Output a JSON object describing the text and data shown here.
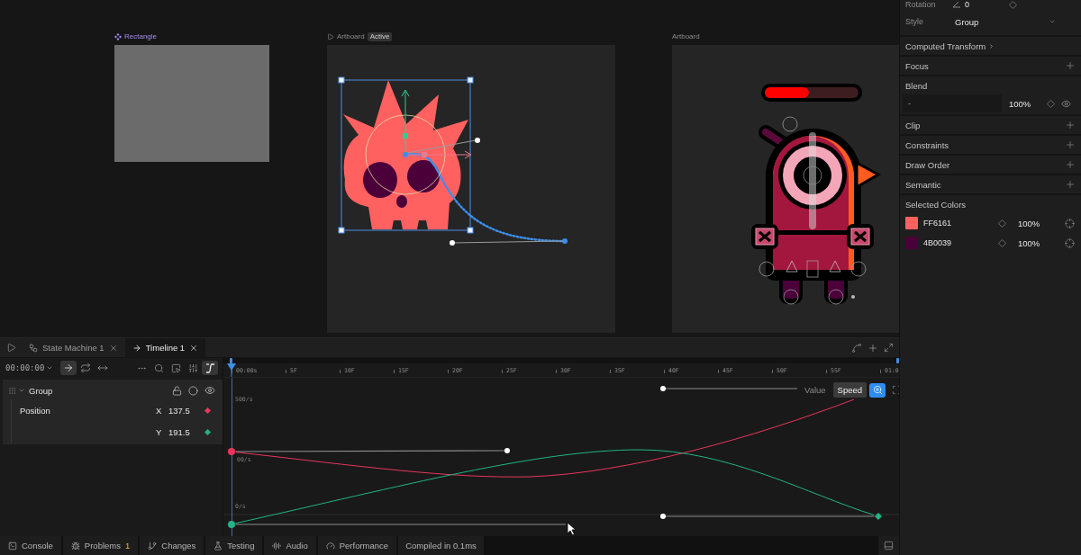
{
  "canvas": {
    "artboards": [
      {
        "kind": "rectangle",
        "label": "Rectangle"
      },
      {
        "kind": "skull",
        "label": "Artboard",
        "badge": "Active"
      },
      {
        "kind": "character",
        "label": "Artboard",
        "health_bar": {
          "level": 0.47
        }
      }
    ]
  },
  "timeline": {
    "tabs": [
      {
        "kind": "state_machine",
        "label": "State Machine 1",
        "selected": false
      },
      {
        "kind": "timeline",
        "label": "Timeline 1",
        "selected": true
      }
    ],
    "time": "00:00:00",
    "playback_modes": [
      {
        "kind": "one_shot",
        "selected": true
      },
      {
        "kind": "loop",
        "selected": false
      },
      {
        "kind": "ping_pong",
        "selected": false
      }
    ],
    "tools": [
      {
        "kind": "more",
        "selected": false
      },
      {
        "kind": "search",
        "selected": false
      },
      {
        "kind": "select",
        "selected": false
      },
      {
        "kind": "filter",
        "selected": false
      },
      {
        "kind": "ease",
        "selected": true
      }
    ],
    "ruler": [
      "00:00s",
      "5F",
      "10F",
      "15F",
      "20F",
      "25F",
      "30F",
      "35F",
      "40F",
      "45F",
      "50F",
      "55F",
      "01:0"
    ],
    "layers": [
      {
        "name": "Group",
        "expanded": true,
        "children": [
          {
            "name": "Position",
            "values": [
              {
                "axis": "X",
                "value": "137.5",
                "color": "#e8365a"
              },
              {
                "axis": "Y",
                "value": "191.5",
                "color": "#20b486"
              }
            ]
          }
        ]
      }
    ],
    "graph": {
      "axis_labels": [
        "500/s",
        "00/s",
        "0/s"
      ],
      "modes": [
        {
          "label": "Value",
          "selected": false
        },
        {
          "label": "Speed",
          "selected": true
        }
      ],
      "buttons": [
        {
          "kind": "zoom",
          "selected": true
        },
        {
          "kind": "fit",
          "selected": false
        }
      ]
    }
  },
  "inspector": {
    "rotation": {
      "label": "Rotation",
      "value": "0"
    },
    "style": {
      "label": "Style",
      "value": "Group"
    },
    "sections": [
      {
        "kind": "link",
        "title": "Computed Transform"
      },
      {
        "kind": "add",
        "title": "Focus"
      },
      {
        "kind": "blend",
        "title": "Blend",
        "mode": "-",
        "opacity": "100%"
      },
      {
        "kind": "add",
        "title": "Clip"
      },
      {
        "kind": "add",
        "title": "Constraints"
      },
      {
        "kind": "add",
        "title": "Draw Order"
      },
      {
        "kind": "add",
        "title": "Semantic"
      },
      {
        "kind": "colors",
        "title": "Selected Colors",
        "colors": [
          {
            "hex": "FF6161",
            "color": "#ff6161",
            "opacity": "100%"
          },
          {
            "hex": "4B0039",
            "color": "#4b0039",
            "opacity": "100%"
          }
        ]
      }
    ]
  },
  "status_bar": {
    "tabs": [
      {
        "kind": "console",
        "label": "Console"
      },
      {
        "kind": "problems",
        "label": "Problems",
        "count": "1"
      },
      {
        "kind": "changes",
        "label": "Changes"
      },
      {
        "kind": "testing",
        "label": "Testing"
      },
      {
        "kind": "audio",
        "label": "Audio"
      },
      {
        "kind": "performance",
        "label": "Performance"
      }
    ],
    "message": "Compiled in 0.1ms"
  }
}
